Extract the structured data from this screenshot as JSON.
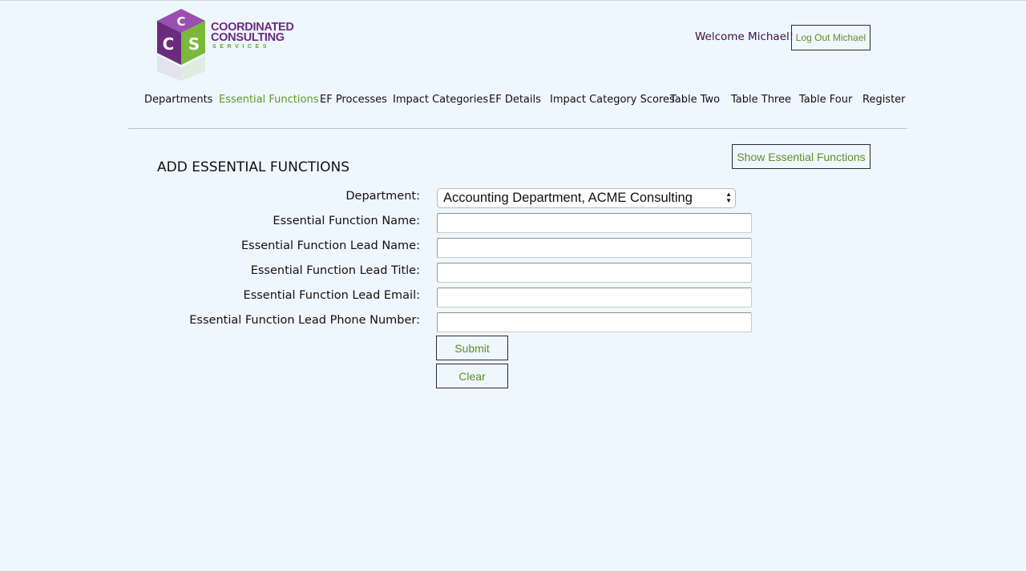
{
  "brand": {
    "logo_letters": [
      "C",
      "C",
      "S"
    ],
    "line1": "COORDINATED",
    "line2": "CONSULTING",
    "line3": "SERVICES",
    "colors": {
      "purple": "#6b2a7d",
      "green": "#6aa12c"
    }
  },
  "header": {
    "welcome": "Welcome Michael!",
    "logout_label": "Log Out Michael"
  },
  "nav": {
    "items": [
      {
        "label": "Departments",
        "active": false
      },
      {
        "label": "Essential Functions",
        "active": true
      },
      {
        "label": "EF Processes",
        "active": false
      },
      {
        "label": "Impact Categories",
        "active": false
      },
      {
        "label": "EF Details",
        "active": false
      },
      {
        "label": "Impact Category Scores",
        "active": false
      },
      {
        "label": "Table Two",
        "active": false
      },
      {
        "label": "Table Three",
        "active": false
      },
      {
        "label": "Table Four",
        "active": false
      },
      {
        "label": "Register",
        "active": false
      }
    ]
  },
  "main": {
    "show_button": "Show Essential Functions",
    "title": "ADD ESSENTIAL FUNCTIONS"
  },
  "form": {
    "department_label": "Department:",
    "department_value": "Accounting Department, ACME Consulting",
    "select_arrows": "▲▼",
    "fields": [
      {
        "label": "Essential Function Name:",
        "value": ""
      },
      {
        "label": "Essential Function Lead Name:",
        "value": ""
      },
      {
        "label": "Essential Function Lead Title:",
        "value": ""
      },
      {
        "label": "Essential Function Lead Email:",
        "value": ""
      },
      {
        "label": "Essential Function Lead Phone Number:",
        "value": ""
      }
    ],
    "submit_label": "Submit",
    "clear_label": "Clear"
  },
  "colors": {
    "background": "#eff7fe",
    "accent_green": "#5e9a24",
    "welcome_text": "#3b1049"
  }
}
